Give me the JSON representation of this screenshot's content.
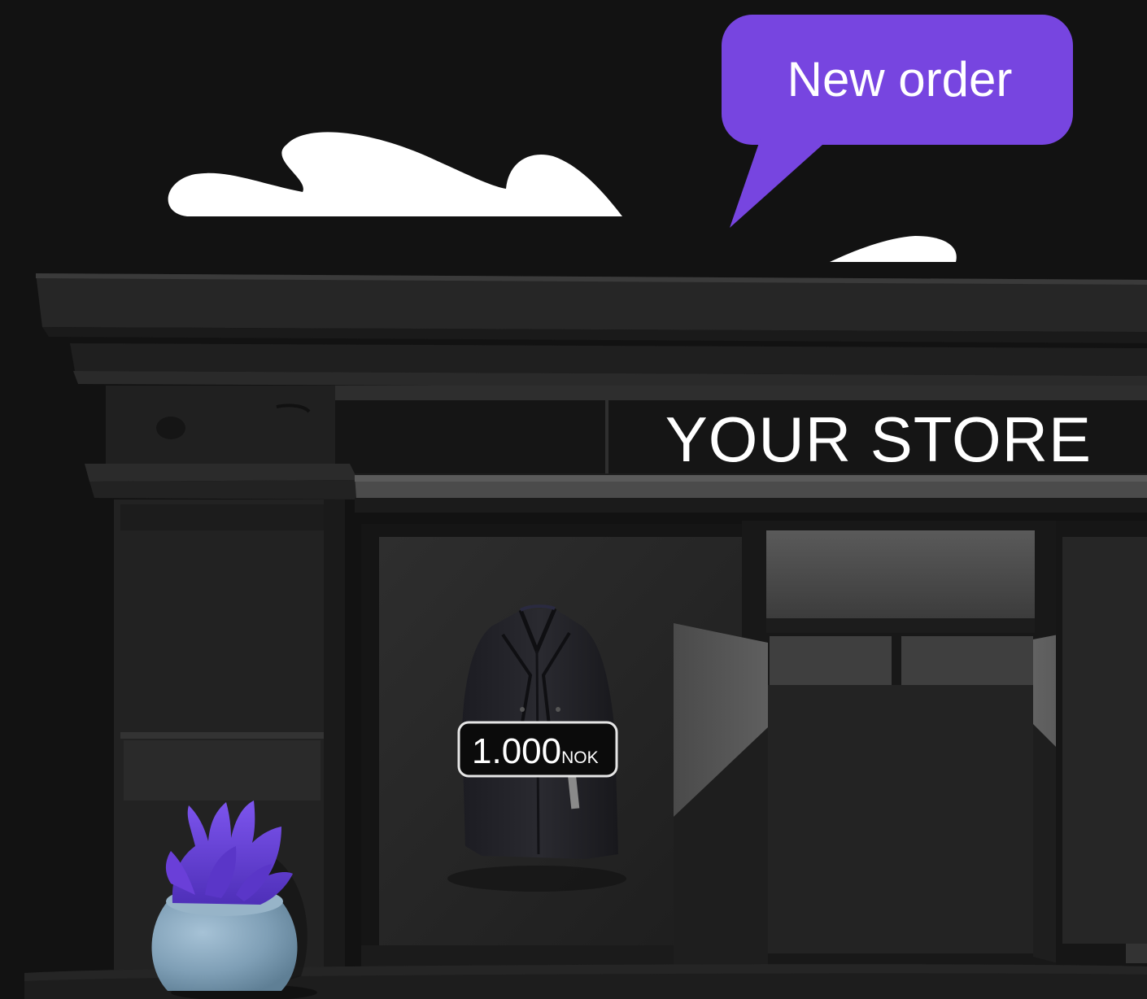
{
  "speech_bubble": {
    "label": "New order",
    "color": "#7745e0"
  },
  "store_sign": {
    "label": "YOUR STORE"
  },
  "price_tag": {
    "value": "1.000",
    "currency": "NOK"
  },
  "colors": {
    "background": "#121212",
    "facade": "#232323",
    "plant_leaves": "#6a3fd8",
    "pot": "#86a6bd"
  },
  "illustration": {
    "icons": [
      "cloud-icon",
      "speech-bubble-icon",
      "storefront-icon",
      "coat-icon",
      "price-tag-icon",
      "potted-plant-icon",
      "shop-door-icon"
    ]
  }
}
